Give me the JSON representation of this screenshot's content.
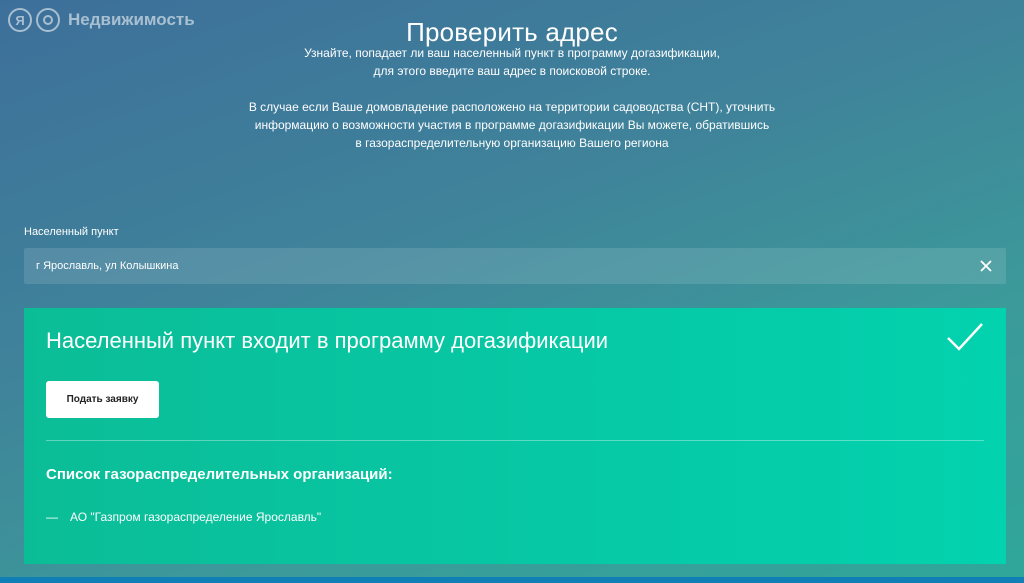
{
  "watermark": {
    "logo_letter": "Я",
    "brand": "Недвижимость"
  },
  "page": {
    "title": "Проверить адрес",
    "intro_lines": [
      "Узнайте, попадает ли ваш населенный пункт в программу догазификации,",
      "для этого введите ваш адрес в поисковой строке."
    ],
    "note_lines": [
      "В случае если Ваше домовладение расположено на территории садоводства (СНТ), уточнить",
      "информацию о возможности участия в программе догазификации Вы можете, обратившись",
      "в газораспределительную организацию Вашего региона"
    ]
  },
  "search": {
    "label": "Населенный пункт",
    "value": "г Ярославль, ул Колышкина"
  },
  "result": {
    "title": "Населенный пункт входит в программу догазификации",
    "apply_label": "Подать заявку",
    "orgs_heading": "Список газораспределительных организаций:",
    "orgs": [
      {
        "bullet": "—",
        "name": "АО \"Газпром газораспределение Ярославль\""
      }
    ]
  },
  "colors": {
    "background": "#3f839a",
    "result_panel": "#06c9a6",
    "bottom_strip": "#0f7fb5"
  }
}
